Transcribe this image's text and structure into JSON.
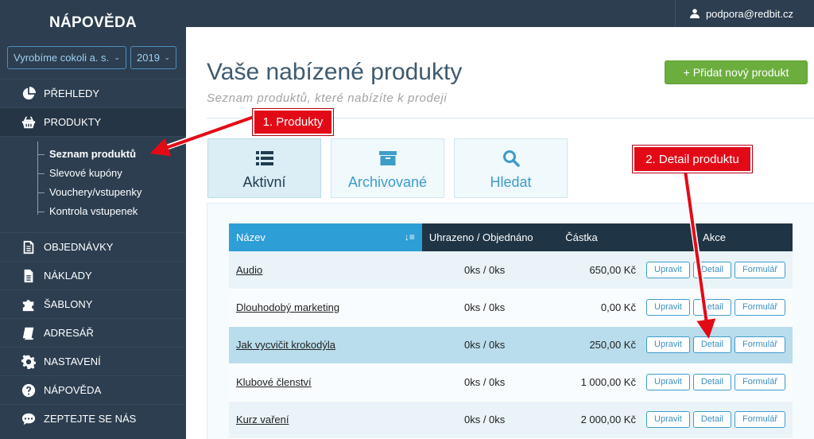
{
  "sidebar": {
    "brand": "NÁPOVĚDA",
    "company_select": "Vyrobíme cokoli a. s.",
    "year_select": "2019",
    "items": [
      {
        "label": "PŘEHLEDY",
        "icon": "pie-chart-icon"
      },
      {
        "label": "PRODUKTY",
        "icon": "basket-icon"
      },
      {
        "label": "OBJEDNÁVKY",
        "icon": "document-icon"
      },
      {
        "label": "NÁKLADY",
        "icon": "file-icon"
      },
      {
        "label": "ŠABLONY",
        "icon": "puzzle-icon"
      },
      {
        "label": "ADRESÁŘ",
        "icon": "book-icon"
      },
      {
        "label": "NASTAVENÍ",
        "icon": "gear-icon"
      },
      {
        "label": "NÁPOVĚDA",
        "icon": "question-icon"
      },
      {
        "label": "ZEPTEJTE SE NÁS",
        "icon": "chat-icon"
      }
    ],
    "submenu": [
      "Seznam produktů",
      "Slevové kupóny",
      "Vouchery/vstupenky",
      "Kontrola vstupenek"
    ]
  },
  "topbar": {
    "user_email": "podpora@redbit.cz"
  },
  "main": {
    "title": "Vaše nabízené produkty",
    "subtitle": "Seznam produktů, které nabízíte k prodeji",
    "add_button": "+ Přidat nový produkt",
    "tabs": [
      {
        "label": "Aktivní",
        "icon": "list-icon"
      },
      {
        "label": "Archivované",
        "icon": "archive-icon"
      },
      {
        "label": "Hledat",
        "icon": "search-icon"
      }
    ]
  },
  "table": {
    "headers": [
      "Název",
      "Uhrazeno / Objednáno",
      "Částka",
      "Akce"
    ],
    "rows": [
      {
        "name": "Audio",
        "paid": "0ks / 0ks",
        "amount": "650,00 Kč"
      },
      {
        "name": "Dlouhodobý marketing",
        "paid": "0ks / 0ks",
        "amount": "0,00 Kč"
      },
      {
        "name": "Jak vycvičit krokodýla",
        "paid": "0ks / 0ks",
        "amount": "250,00 Kč"
      },
      {
        "name": "Klubové členství",
        "paid": "0ks / 0ks",
        "amount": "1 000,00 Kč"
      },
      {
        "name": "Kurz vaření",
        "paid": "0ks / 0ks",
        "amount": "2 000,00 Kč"
      }
    ],
    "actions": {
      "edit": "Upravit",
      "detail": "Detail",
      "form": "Formulář"
    }
  },
  "annotations": {
    "callout1": "1. Produkty",
    "callout2": "2. Detail produktu"
  },
  "colors": {
    "sidebar": "#2c3e50",
    "accent_blue": "#2d9ed6",
    "add_button_green": "#6cae3e",
    "annotation_red": "#e30a17",
    "highlight_row": "#b9ddec"
  }
}
